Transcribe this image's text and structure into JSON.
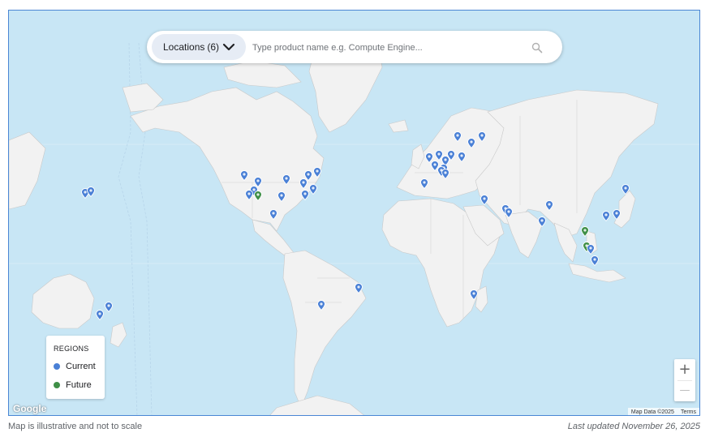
{
  "search": {
    "locations_label": "Locations",
    "locations_count": "(6)",
    "placeholder": "Type product name e.g. Compute Engine..."
  },
  "legend": {
    "title": "REGIONS",
    "items": [
      {
        "label": "Current",
        "color": "#4a80d6"
      },
      {
        "label": "Future",
        "color": "#3f8f47"
      }
    ]
  },
  "zoom": {
    "in_label": "+",
    "out_label": "—"
  },
  "map": {
    "logo": "Google",
    "attribution": "Map Data ©2025",
    "terms": "Terms",
    "colors": {
      "water": "#c8e6f5",
      "land": "#f2f2f2",
      "current": "#4a80d6",
      "future": "#3f8f47"
    }
  },
  "footer": {
    "disclaimer": "Map is illustrative and not to scale",
    "updated": "Last updated November 26, 2025"
  }
}
